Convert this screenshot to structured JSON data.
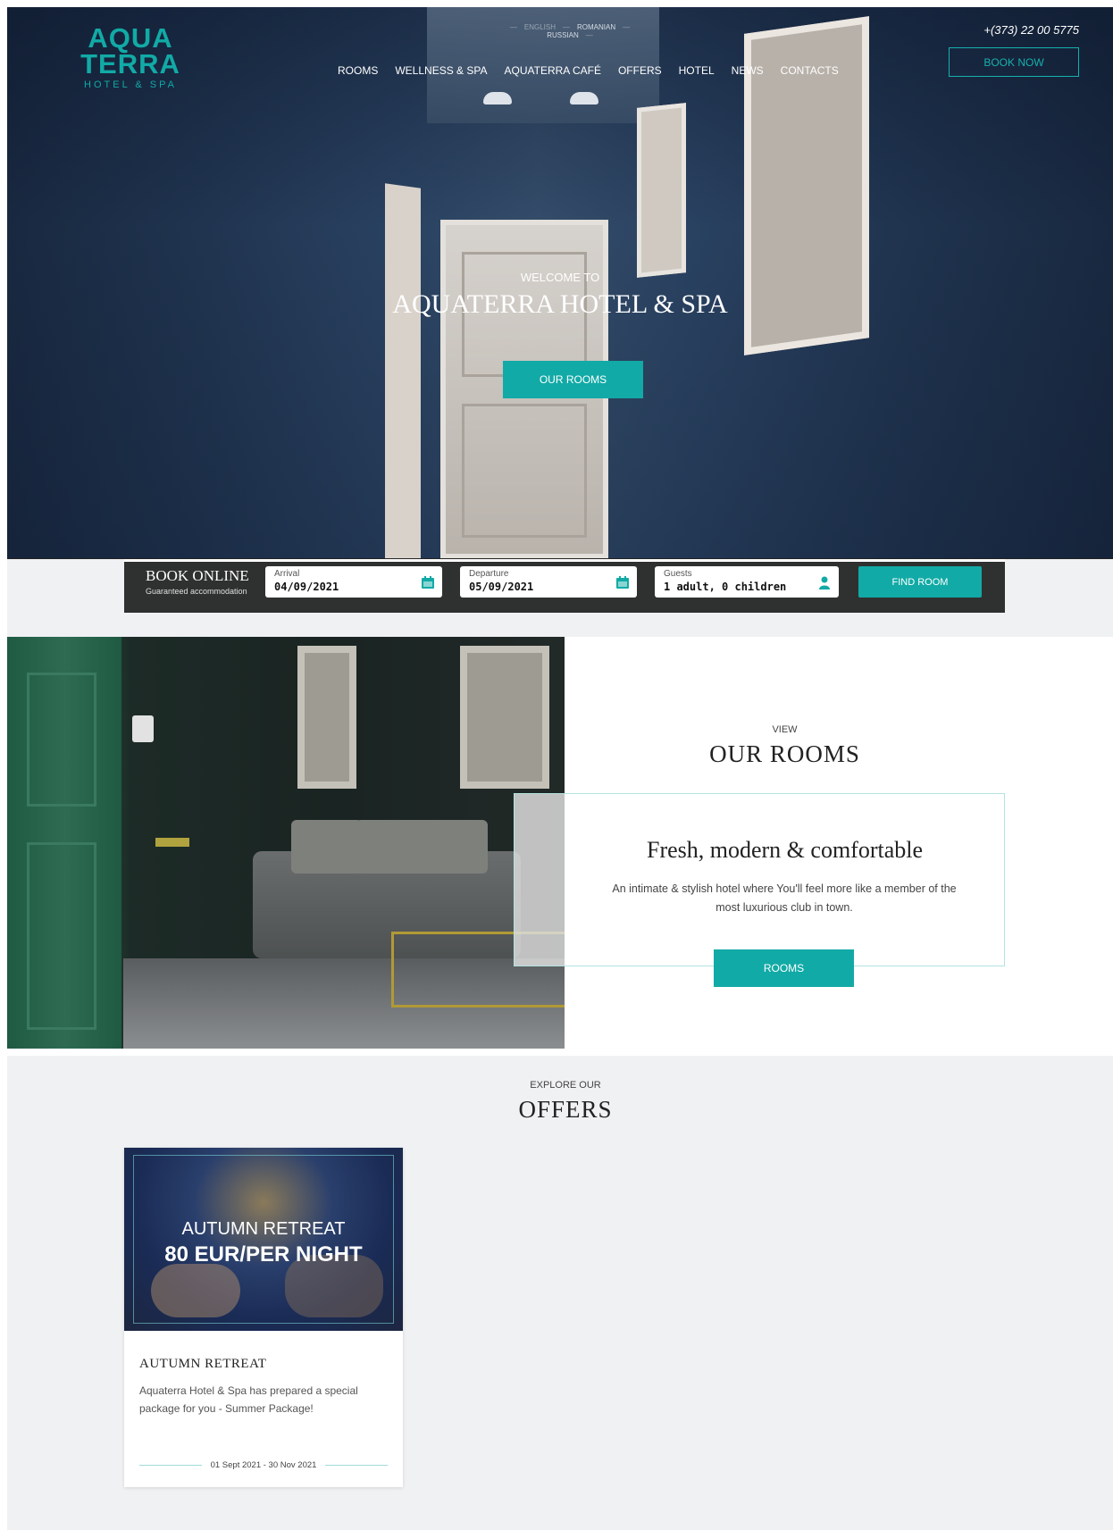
{
  "logo": {
    "line1": "AQUA",
    "line2": "TERRA",
    "sub": "HOTEL & SPA"
  },
  "languages": [
    "ENGLISH",
    "ROMANIAN",
    "RUSSIAN"
  ],
  "nav": [
    "ROOMS",
    "WELLNESS & SPA",
    "AQUATERRA CAFÉ",
    "OFFERS",
    "HOTEL",
    "NEWS",
    "CONTACTS"
  ],
  "phone": "+(373) 22 00 5775",
  "book_now": "BOOK NOW",
  "hero": {
    "welcome": "WELCOME TO",
    "title": "AQUATERRA HOTEL & SPA",
    "button": "OUR ROOMS"
  },
  "booking": {
    "title": "BOOK ONLINE",
    "subtitle": "Guaranteed accommodation",
    "arrival_label": "Arrival",
    "arrival_value": "04/09/2021",
    "departure_label": "Departure",
    "departure_value": "05/09/2021",
    "guests_label": "Guests",
    "guests_value": "1 adult, 0 children",
    "find_button": "FIND ROOM"
  },
  "rooms_section": {
    "kicker": "VIEW",
    "title": "OUR ROOMS",
    "heading": "Fresh, modern & comfortable",
    "description": "An intimate & stylish hotel where You'll feel more like a member of the most luxurious club in town.",
    "button": "ROOMS"
  },
  "offers_section": {
    "kicker": "EXPLORE OUR",
    "title": "OFFERS",
    "cards": [
      {
        "image_line1": "AUTUMN RETREAT",
        "image_line2": "80 EUR/PER NIGHT",
        "title": "AUTUMN RETREAT",
        "description": "Aquaterra Hotel & Spa has prepared a special package for you - Summer Package!",
        "dates": "01 Sept 2021 - 30 Nov 2021"
      }
    ]
  },
  "colors": {
    "accent": "#12aaa6",
    "bookbar": "#2f3030",
    "band": "#f0f1f3"
  }
}
